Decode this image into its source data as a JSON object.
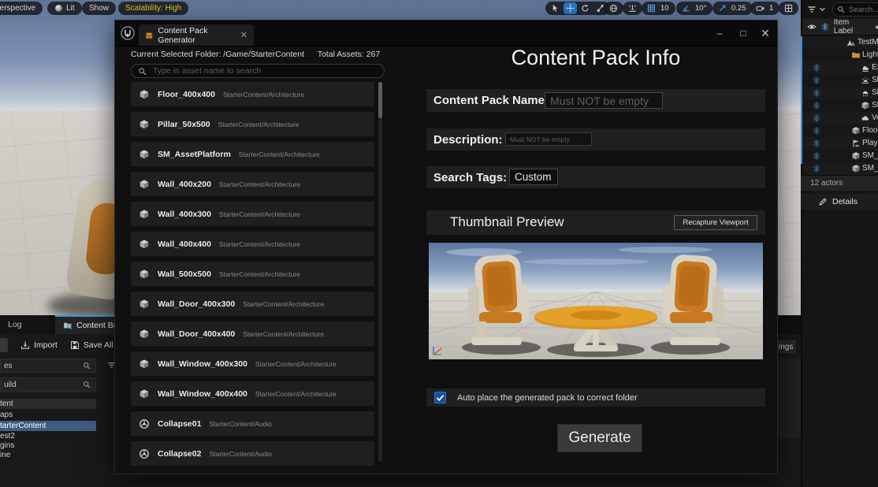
{
  "viewport_toolbar": {
    "perspective": "Perspective",
    "lit": "Lit",
    "show": "Show",
    "scalability": "Scalability: High",
    "grid_snap": "10",
    "angle_snap": "10°",
    "scale_snap": "0.25",
    "camera_speed": "1"
  },
  "outliner": {
    "search_placeholder": "Search...",
    "header_label": "Item Label",
    "rows": [
      {
        "label": "TestM",
        "icon": "level-icon",
        "indent": 56,
        "flake": false
      },
      {
        "label": "Light",
        "icon": "folder-icon",
        "indent": 62,
        "flake": false
      },
      {
        "label": "Ex",
        "icon": "fog-icon",
        "indent": 74,
        "flake": true
      },
      {
        "label": "Sk",
        "icon": "sky-atmosphere-icon",
        "indent": 74,
        "flake": true
      },
      {
        "label": "Sk",
        "icon": "sky-light-icon",
        "indent": 74,
        "flake": true
      },
      {
        "label": "SM",
        "icon": "static-mesh-icon",
        "indent": 74,
        "flake": true
      },
      {
        "label": "Vo",
        "icon": "volumetric-cloud-icon",
        "indent": 74,
        "flake": true
      },
      {
        "label": "Floo",
        "icon": "static-mesh-icon",
        "indent": 62,
        "flake": true
      },
      {
        "label": "Play",
        "icon": "player-start-icon",
        "indent": 62,
        "flake": true
      },
      {
        "label": "SM_",
        "icon": "static-mesh-icon",
        "indent": 62,
        "flake": true
      },
      {
        "label": "SM_",
        "icon": "static-mesh-icon",
        "indent": 62,
        "flake": true
      }
    ],
    "footer": "12 actors",
    "details_label": "Details"
  },
  "content_browser": {
    "tab_log": "Log",
    "tab_content_browser": "Content Brow",
    "import_label": "Import",
    "save_all_label": "Save All",
    "settings_fragment": "ings",
    "search_top_fragment": "es",
    "search_bottom_fragment": "uild",
    "tree": [
      {
        "label": "tent",
        "selected": false,
        "light": true
      },
      {
        "label": "aps",
        "selected": false,
        "light": false
      },
      {
        "label": "tarterContent",
        "selected": true,
        "light": false
      },
      {
        "label": "est2",
        "selected": false,
        "light": false
      },
      {
        "label": "gins",
        "selected": false,
        "light": false
      },
      {
        "label": "ine",
        "selected": false,
        "light": false
      }
    ]
  },
  "dialog": {
    "tab_title": "Content Pack Generator",
    "info_folder": "Current Selected Folder: /Game/StarterContent",
    "info_total": "Total Assets: 267",
    "search_placeholder": "Type in asset name to search",
    "assets": [
      {
        "name": "Floor_400x400",
        "path": "StarterContent/Architecture",
        "icon": "mesh-icon"
      },
      {
        "name": "Pillar_50x500",
        "path": "StarterContent/Architecture",
        "icon": "mesh-icon"
      },
      {
        "name": "SM_AssetPlatform",
        "path": "StarterContent/Architecture",
        "icon": "mesh-icon"
      },
      {
        "name": "Wall_400x200",
        "path": "StarterContent/Architecture",
        "icon": "mesh-icon"
      },
      {
        "name": "Wall_400x300",
        "path": "StarterContent/Architecture",
        "icon": "mesh-icon"
      },
      {
        "name": "Wall_400x400",
        "path": "StarterContent/Architecture",
        "icon": "mesh-icon"
      },
      {
        "name": "Wall_500x500",
        "path": "StarterContent/Architecture",
        "icon": "mesh-icon"
      },
      {
        "name": "Wall_Door_400x300",
        "path": "StarterContent/Architecture",
        "icon": "mesh-icon"
      },
      {
        "name": "Wall_Door_400x400",
        "path": "StarterContent/Architecture",
        "icon": "mesh-icon"
      },
      {
        "name": "Wall_Window_400x300",
        "path": "StarterContent/Architecture",
        "icon": "mesh-icon"
      },
      {
        "name": "Wall_Window_400x400",
        "path": "StarterContent/Architecture",
        "icon": "mesh-icon"
      },
      {
        "name": "Collapse01",
        "path": "StarterContent/Audio",
        "icon": "audio-icon"
      },
      {
        "name": "Collapse02",
        "path": "StarterContent/Audio",
        "icon": "audio-icon"
      }
    ],
    "panel_title": "Content Pack Info",
    "fields": {
      "name_label": "Content Pack Name:",
      "name_placeholder": "Must NOT be empty",
      "desc_label": "Description:",
      "desc_placeholder": "Must NOT be empty",
      "tags_label": "Search Tags:",
      "tags_value": "Custom"
    },
    "thumbnail_title": "Thumbnail Preview",
    "recapture_label": "Recapture Viewport",
    "checkbox_label": "Auto place the generated pack to correct folder",
    "generate_label": "Generate"
  }
}
